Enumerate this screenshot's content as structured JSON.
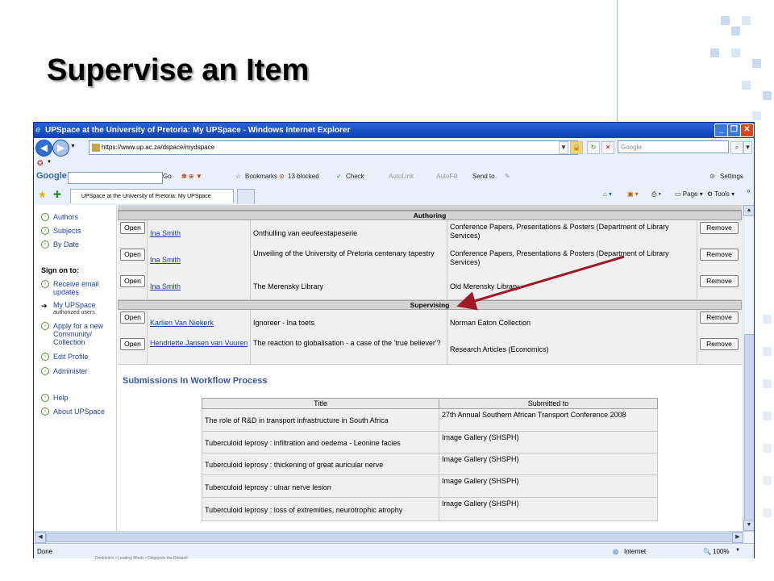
{
  "slide": {
    "title": "Supervise an Item"
  },
  "window": {
    "title": "UPSpace at the University of Pretoria: My UPSpace - Windows Internet Explorer",
    "address": "https://www.up.ac.za/dspace/mydspace",
    "search_placeholder": "Google"
  },
  "toolbar": {
    "google_label": "Google",
    "go_label": "Go",
    "bookmarks_label": "Bookmarks",
    "blocked_label": "13 blocked",
    "check_label": "Check",
    "autolink_label": "AutoLink",
    "autofill_label": "AutoFill",
    "sendto_label": "Send to",
    "settings_label": "Settings"
  },
  "tabs": [
    {
      "label": "UPSpace at the University of Pretoria: My UPSpace"
    }
  ],
  "cmdbar": {
    "page_label": "Page",
    "tools_label": "Tools"
  },
  "sidebar": {
    "links_top": [
      "Authors",
      "Subjects",
      "By Date"
    ],
    "sign_on_heading": "Sign on to:",
    "receive_email": "Receive email updates",
    "my_upspace": "My UPSpace",
    "authorized_users": "authorized users",
    "apply_community": "Apply for a new Community/ Collection",
    "edit_profile": "Edit Profile",
    "administer": "Administer",
    "help": "Help",
    "about": "About UPSpace"
  },
  "table": {
    "authoring_heading": "Authoring",
    "supervising_heading": "Supervising",
    "open_label": "Open",
    "remove_label": "Remove",
    "authoring_rows": [
      {
        "person": "Ina Smith",
        "title": "Onthulling van eeufeestapeserie",
        "submitted_to": "Conference Papers, Presentations & Posters (Department of Library Services)"
      },
      {
        "person": "Ina Smith",
        "title": "Unveiling of the University of Pretoria centenary tapestry",
        "submitted_to": "Conference Papers, Presentations & Posters (Department of Library Services)"
      },
      {
        "person": "Ina Smith",
        "title": "The Merensky Library",
        "submitted_to": "Old Merensky Library"
      }
    ],
    "supervising_rows": [
      {
        "person": "Karlien Van Niekerk",
        "title": "Ignoreer - Ina toets",
        "submitted_to": "Norman Eaton Collection"
      },
      {
        "person": "Hendriette Jansen van Vuuren",
        "title": "The reaction to globalisation - a case of the 'true believer'?",
        "submitted_to": "Research Articles (Economics)"
      }
    ]
  },
  "workflow": {
    "heading": "Submissions In Workflow Process",
    "col_title": "Title",
    "col_submitted": "Submitted to",
    "rows": [
      {
        "title": "The role of R&D in transport infrastructure in South Africa",
        "submitted_to": "27th Annual Southern African Transport Conference 2008"
      },
      {
        "title": "Tuberculoid leprosy : infiltration and oedema - Leonine facies",
        "submitted_to": "Image Gallery (SHSPH)"
      },
      {
        "title": "Tuberculoid leprosy : thickening of great auricular nerve",
        "submitted_to": "Image Gallery (SHSPH)"
      },
      {
        "title": "Tuberculoid leprosy : ulnar nerve lesion",
        "submitted_to": "Image Gallery (SHSPH)"
      },
      {
        "title": "Tuberculoid leprosy : loss of extremities, neurotrophic atrophy",
        "submitted_to": "Image Gallery (SHSPH)"
      }
    ]
  },
  "statusbar": {
    "status_text": "Done",
    "zone": "Internet",
    "zoom": "100%"
  },
  "footer": {
    "motto": "Denkleiers • Leading Minds • Dikgopolo tša Dihlalefi"
  },
  "colors": {
    "accent": "#0c3fb6",
    "link": "#1f3ea0",
    "arrow": "#a01828"
  }
}
